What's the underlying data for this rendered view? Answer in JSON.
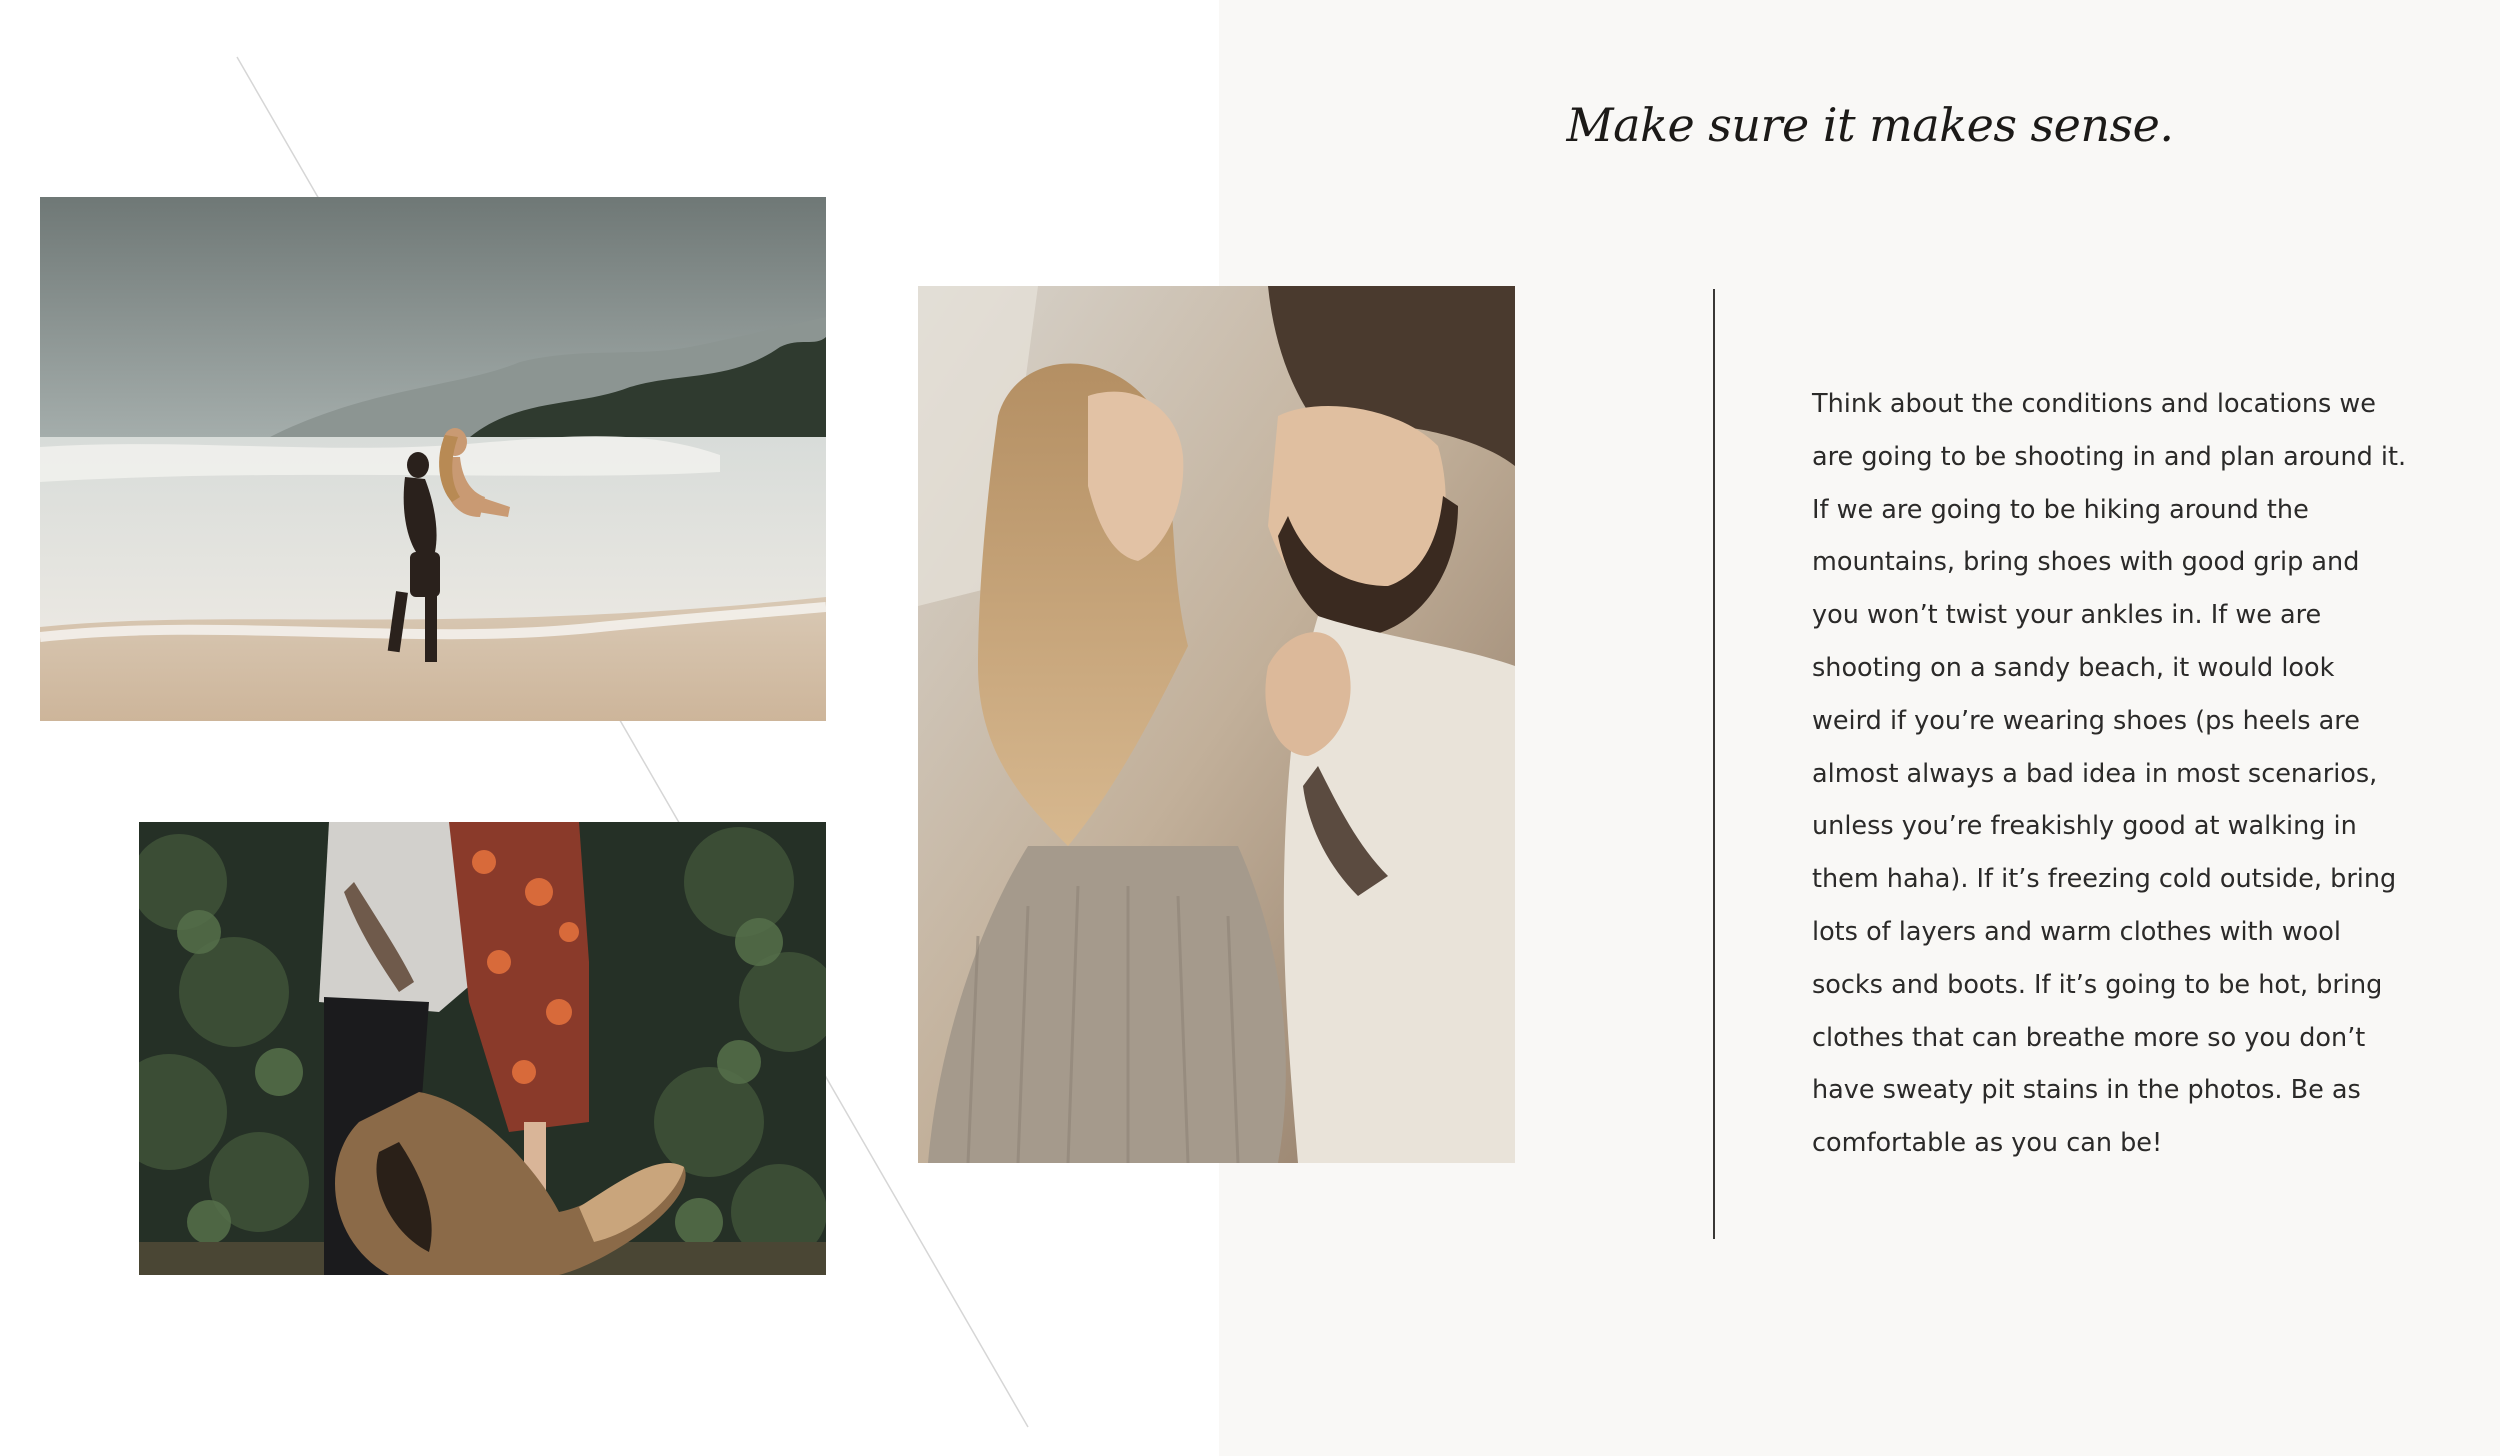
{
  "heading": "Make sure it makes sense.",
  "body": "Think about the conditions and locations we are going to be shooting in and plan around it. If we are going to be hiking around the mountains, bring shoes with good grip and you won’t twist your ankles in. If we are shooting on a sandy beach, it would look weird if you’re wearing shoes (ps heels are almost always a bad idea in most scenarios, unless you’re freakishly good at walking in them haha). If it’s freezing cold outside, bring lots of layers and warm clothes with wool socks and boots. If it’s going to be hot, bring clothes that can breathe more so you don’t have sweaty pit stains in the photos. Be as comfortable as you can be!",
  "colors": {
    "panel_background": "#f9f8f6",
    "text": "#2b2a29",
    "heading": "#1c1a18",
    "rule": "#3a3836"
  }
}
